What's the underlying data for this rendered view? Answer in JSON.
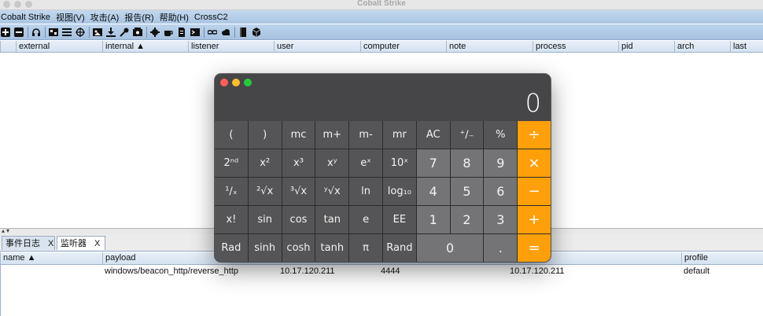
{
  "window": {
    "title": "Cobalt Strike"
  },
  "menu": [
    "Cobalt Strike",
    "视图(V)",
    "攻击(A)",
    "报告(R)",
    "帮助(H)",
    "CrossC2"
  ],
  "toolbar_icons": [
    "plus-icon",
    "minus-icon",
    "headphones-icon",
    "screen-icon",
    "list-icon",
    "target-icon",
    "image-icon",
    "download-icon",
    "key-icon",
    "picture-icon",
    "gear-icon",
    "coffee-icon",
    "document-icon",
    "terminal-icon",
    "link-icon",
    "cloud-icon",
    "book-icon",
    "cube-icon"
  ],
  "beacon_table": {
    "columns": [
      "external",
      "internal ▲",
      "listener",
      "user",
      "computer",
      "note",
      "process",
      "pid",
      "arch",
      "last"
    ]
  },
  "tabs": [
    {
      "label": "事件日志",
      "close": "X"
    },
    {
      "label": "监听器",
      "close": "X"
    }
  ],
  "listener_table": {
    "columns": [
      "name ▲",
      "payload",
      "profile"
    ],
    "rows": [
      {
        "payload": "windows/beacon_http/reverse_http",
        "host": "10.17.120.211",
        "port": "4444",
        "bindto": "10.17.120.211",
        "profile": "default"
      }
    ]
  },
  "calculator": {
    "display": "0",
    "keys": [
      [
        "(",
        ")",
        "mc",
        "m+",
        "m-",
        "mr",
        "AC",
        "⁺∕₋",
        "%",
        "÷"
      ],
      [
        "2ⁿᵈ",
        "x²",
        "x³",
        "xʸ",
        "eˣ",
        "10ˣ",
        "7",
        "8",
        "9",
        "×"
      ],
      [
        "¹∕ₓ",
        "²√x",
        "³√x",
        "ʸ√x",
        "ln",
        "log₁₀",
        "4",
        "5",
        "6",
        "−"
      ],
      [
        "x!",
        "sin",
        "cos",
        "tan",
        "e",
        "EE",
        "1",
        "2",
        "3",
        "+"
      ],
      [
        "Rad",
        "sinh",
        "cosh",
        "tanh",
        "π",
        "Rand",
        "0",
        ".",
        "="
      ]
    ],
    "colors": {
      "op": "#ff9f0a",
      "num": "#747476",
      "fn": "#555557",
      "close": "#ff5f57",
      "min": "#febc2e",
      "max": "#28c840"
    }
  }
}
